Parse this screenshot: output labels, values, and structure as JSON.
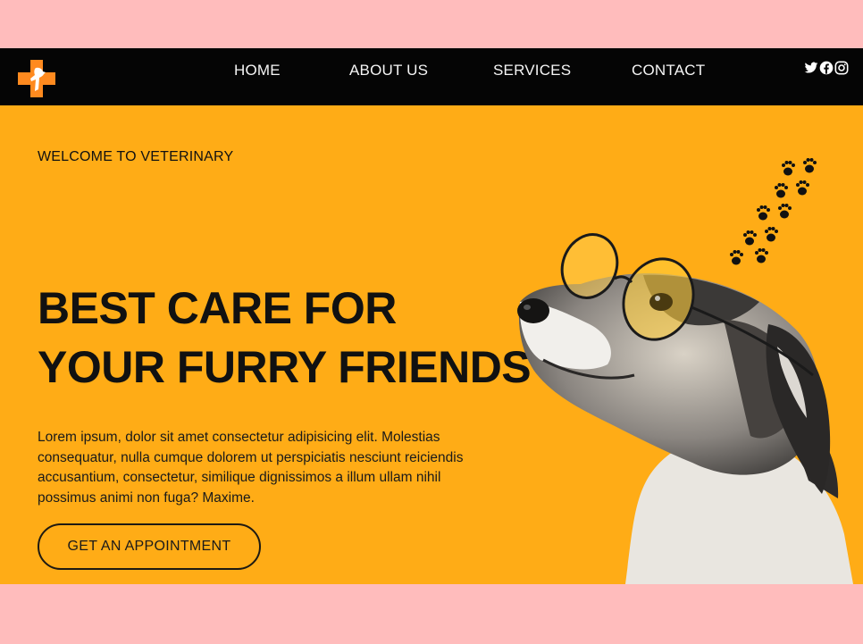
{
  "nav": {
    "items": [
      {
        "label": "HOME"
      },
      {
        "label": "ABOUT US"
      },
      {
        "label": "SERVICES"
      },
      {
        "label": "CONTACT"
      }
    ],
    "social_icons": [
      "twitter-icon",
      "facebook-icon",
      "instagram-icon"
    ]
  },
  "hero": {
    "welcome": "WELCOME TO VETERINARY",
    "headline_line1": "BEST CARE FOR",
    "headline_line2": "YOUR FURRY FRIENDS",
    "description": "Lorem ipsum, dolor sit amet consectetur adipisicing elit. Molestias consequatur, nulla cumque dolorem ut perspiciatis nesciunt reiciendis accusantium, consectetur, similique dignissimos a illum ullam nihil possimus animi non fuga? Maxime.",
    "cta_label": "GET AN APPOINTMENT"
  },
  "colors": {
    "page_background": "#ffbcbc",
    "navbar": "#050505",
    "hero_background": "#ffac16",
    "logo_accent": "#ff8a1f"
  }
}
